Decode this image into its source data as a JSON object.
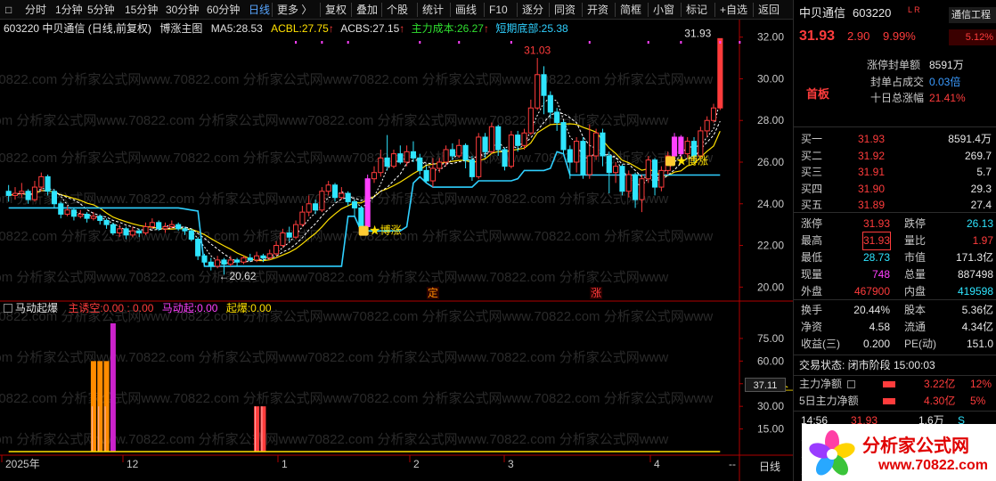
{
  "toolbar": {
    "items": [
      "分时",
      "1分钟",
      "5分钟",
      "15分钟",
      "30分钟",
      "60分钟",
      "日线",
      "更多 〉",
      "复权",
      "叠加",
      "个股",
      "统计",
      "画线",
      "F10",
      "逐分",
      "同资",
      "开资",
      "简框",
      "小窗",
      "标记",
      "+自选",
      "返回"
    ],
    "active_index": 6
  },
  "main_legend": {
    "code_name": "603220 中贝通信 (日线,前复权)",
    "indicator": "博涨主图",
    "ma5_label": "MA5:",
    "ma5_value": "28.53",
    "acbl_label": "ACBL:",
    "acbl_value": "27.75",
    "acbs_label": "ACBS:",
    "acbs_value": "27.15",
    "zlcb_label": "主力成本:",
    "zlcb_value": "26.27",
    "dqdb_label": "短期底部:",
    "dqdb_value": "25.38"
  },
  "sub_legend": {
    "name": "马动起爆",
    "zyk_label": "主诱空:",
    "zyk_value": "0.00 : 0.00",
    "mdq_label": "马动起:",
    "mdq_value": "0.00",
    "qb_label": "起爆:",
    "qb_value": "0.00"
  },
  "annotations": {
    "peak_label": "31.03",
    "low_label": "←20.62",
    "last_label": "31.93",
    "bozhang_1": "博涨",
    "bozhang_2": "博涨",
    "qibao": "起爆",
    "ding": "定",
    "zhang": "涨",
    "crosshair_value": "37.11"
  },
  "watermark": "70822.com 分析家公式网www.70822.com 分析家公式网www",
  "chart_data": [
    {
      "type": "candlestick",
      "ylim": [
        19.5,
        32.5
      ],
      "yticks": [
        "32.00",
        "30.00",
        "28.00",
        "26.00",
        "24.00",
        "22.00",
        "20.00"
      ],
      "ytick_values": [
        32,
        30,
        28,
        26,
        24,
        22,
        20
      ],
      "xlabels": [
        "2025年",
        "12",
        "1",
        "2",
        "3",
        "4"
      ],
      "candles": [
        [
          24.6,
          24.4,
          24.9,
          24.1
        ],
        [
          24.4,
          24.5,
          24.8,
          24.2
        ],
        [
          24.5,
          24.6,
          25.0,
          24.3
        ],
        [
          24.6,
          24.2,
          24.7,
          24.0
        ],
        [
          24.2,
          24.8,
          25.1,
          24.1
        ],
        [
          24.8,
          25.3,
          25.5,
          24.6
        ],
        [
          25.3,
          24.6,
          25.4,
          24.4
        ],
        [
          24.6,
          24.0,
          24.7,
          23.8
        ],
        [
          24.0,
          23.5,
          24.1,
          23.3
        ],
        [
          23.5,
          23.7,
          23.9,
          23.4
        ],
        [
          23.7,
          23.4,
          23.8,
          23.2
        ],
        [
          23.4,
          23.5,
          23.7,
          23.3
        ],
        [
          23.5,
          23.3,
          23.6,
          23.1
        ],
        [
          23.3,
          23.4,
          23.6,
          23.2
        ],
        [
          23.4,
          23.2,
          23.5,
          23.0
        ],
        [
          23.2,
          23.0,
          23.3,
          22.8
        ],
        [
          23.0,
          22.6,
          23.1,
          22.5
        ],
        [
          22.6,
          22.8,
          23.0,
          22.4
        ],
        [
          22.8,
          22.5,
          22.9,
          22.3
        ],
        [
          22.5,
          22.7,
          22.9,
          22.4
        ],
        [
          22.7,
          22.6,
          22.8,
          22.4
        ],
        [
          22.6,
          22.9,
          23.1,
          22.5
        ],
        [
          22.9,
          23.1,
          23.3,
          22.8
        ],
        [
          23.1,
          22.8,
          23.2,
          22.7
        ],
        [
          22.8,
          22.9,
          23.1,
          22.6
        ],
        [
          22.9,
          23.0,
          23.2,
          22.8
        ],
        [
          23.0,
          22.8,
          23.1,
          22.7
        ],
        [
          22.8,
          22.7,
          22.9,
          22.5
        ],
        [
          22.7,
          22.3,
          22.8,
          22.2
        ],
        [
          22.3,
          21.5,
          22.4,
          21.3
        ],
        [
          21.5,
          21.2,
          21.6,
          21.0
        ],
        [
          21.2,
          21.0,
          21.4,
          20.8
        ],
        [
          21.0,
          21.3,
          21.5,
          20.9
        ],
        [
          21.3,
          21.1,
          21.4,
          20.6
        ],
        [
          21.1,
          21.3,
          21.5,
          21.0
        ],
        [
          21.3,
          21.2,
          21.4,
          21.0
        ],
        [
          21.2,
          21.4,
          21.5,
          21.1
        ],
        [
          21.4,
          21.3,
          21.6,
          21.2
        ],
        [
          21.3,
          21.5,
          21.7,
          21.2
        ],
        [
          21.5,
          21.4,
          21.6,
          21.2
        ],
        [
          21.4,
          21.6,
          21.8,
          21.3
        ],
        [
          21.6,
          22.0,
          22.2,
          21.5
        ],
        [
          22.0,
          22.6,
          22.8,
          21.9
        ],
        [
          22.6,
          22.4,
          22.9,
          22.2
        ],
        [
          22.4,
          23.0,
          23.2,
          22.3
        ],
        [
          23.0,
          23.6,
          23.9,
          22.9
        ],
        [
          23.6,
          24.0,
          24.4,
          23.4
        ],
        [
          24.0,
          23.7,
          24.2,
          23.5
        ],
        [
          23.7,
          24.6,
          24.8,
          23.6
        ],
        [
          24.6,
          24.9,
          25.1,
          24.4
        ],
        [
          24.9,
          24.3,
          25.0,
          24.1
        ],
        [
          24.3,
          24.5,
          24.8,
          24.2
        ],
        [
          24.5,
          24.1,
          24.6,
          23.9
        ],
        [
          24.1,
          23.8,
          24.2,
          23.4
        ],
        [
          23.8,
          22.9,
          23.9,
          22.7
        ],
        [
          22.9,
          25.2,
          25.4,
          22.9
        ],
        [
          25.2,
          25.5,
          25.8,
          25.0
        ],
        [
          25.5,
          26.2,
          26.6,
          25.3
        ],
        [
          26.2,
          25.8,
          27.3,
          25.6
        ],
        [
          25.8,
          26.4,
          26.6,
          25.7
        ],
        [
          26.4,
          26.0,
          26.8,
          25.9
        ],
        [
          26.0,
          26.5,
          26.8,
          25.8
        ],
        [
          26.5,
          26.2,
          27.0,
          26.0
        ],
        [
          26.2,
          25.6,
          26.4,
          25.4
        ],
        [
          25.6,
          25.1,
          25.8,
          25.0
        ],
        [
          25.1,
          25.7,
          26.2,
          24.8
        ],
        [
          25.7,
          26.0,
          26.2,
          25.5
        ],
        [
          26.0,
          26.6,
          26.8,
          25.8
        ],
        [
          26.6,
          26.3,
          26.9,
          26.1
        ],
        [
          26.3,
          26.8,
          27.1,
          26.2
        ],
        [
          26.8,
          26.1,
          26.9,
          25.7
        ],
        [
          26.1,
          25.3,
          26.3,
          25.1
        ],
        [
          25.3,
          27.2,
          27.4,
          25.2
        ],
        [
          27.2,
          26.5,
          27.4,
          26.2
        ],
        [
          26.5,
          27.7,
          27.9,
          26.4
        ],
        [
          27.7,
          26.6,
          27.8,
          26.3
        ],
        [
          26.6,
          25.8,
          26.7,
          25.6
        ],
        [
          25.8,
          27.3,
          27.5,
          25.7
        ],
        [
          27.3,
          26.8,
          27.5,
          26.5
        ],
        [
          26.8,
          27.4,
          27.6,
          26.6
        ],
        [
          27.4,
          28.6,
          29.0,
          27.3
        ],
        [
          28.6,
          30.2,
          31.0,
          28.5
        ],
        [
          30.2,
          29.2,
          30.6,
          28.3
        ],
        [
          29.2,
          28.4,
          29.4,
          28.1
        ],
        [
          28.4,
          27.9,
          28.6,
          27.5
        ],
        [
          27.9,
          26.6,
          28.0,
          26.4
        ],
        [
          26.6,
          26.0,
          26.8,
          25.2
        ],
        [
          26.0,
          27.0,
          27.2,
          25.5
        ],
        [
          27.0,
          25.4,
          27.2,
          25.2
        ],
        [
          25.4,
          26.3,
          27.8,
          25.2
        ],
        [
          26.3,
          27.4,
          27.6,
          26.1
        ],
        [
          27.4,
          26.3,
          27.6,
          25.8
        ],
        [
          26.3,
          25.5,
          26.5,
          24.5
        ],
        [
          25.5,
          25.8,
          26.0,
          25.0
        ],
        [
          25.8,
          24.6,
          25.9,
          24.4
        ],
        [
          24.6,
          25.4,
          25.6,
          24.3
        ],
        [
          25.4,
          24.2,
          25.5,
          23.8
        ],
        [
          24.2,
          25.2,
          25.4,
          23.6
        ],
        [
          25.2,
          26.1,
          26.3,
          25.0
        ],
        [
          26.1,
          24.8,
          26.2,
          24.4
        ],
        [
          24.8,
          25.6,
          25.8,
          24.6
        ],
        [
          25.6,
          26.3,
          26.5,
          25.4
        ],
        [
          26.3,
          27.2,
          27.4,
          26.2
        ],
        [
          27.2,
          26.4,
          27.3,
          26.1
        ],
        [
          26.4,
          27.0,
          27.2,
          26.2
        ],
        [
          27.0,
          26.3,
          27.2,
          26.0
        ],
        [
          26.3,
          27.5,
          27.7,
          26.2
        ],
        [
          27.5,
          28.0,
          28.2,
          27.2
        ],
        [
          28.0,
          28.6,
          28.8,
          27.9
        ],
        [
          28.6,
          31.93,
          31.93,
          28.5
        ]
      ],
      "ma_series": [
        {
          "name": "ACBL",
          "color": "#ffe000"
        },
        {
          "name": "ACBS",
          "color": "#ffffff"
        },
        {
          "name": "MA5",
          "color": "#ffffff"
        }
      ],
      "dqdb_line_color": "#2fd0ff"
    },
    {
      "type": "bar",
      "ylim": [
        0,
        85
      ],
      "yticks": [
        "75.00",
        "60.00",
        "45.00",
        "30.00",
        "15.00"
      ],
      "ytick_values": [
        75,
        60,
        45,
        30,
        15
      ],
      "bars": [
        {
          "x_index": 13,
          "value": 60,
          "color": "#ff8c00"
        },
        {
          "x_index": 14,
          "value": 60,
          "color": "#ff8c00"
        },
        {
          "x_index": 15,
          "value": 60,
          "color": "#ff8c00"
        },
        {
          "x_index": 16,
          "value": 85,
          "color": "#cc22cc"
        },
        {
          "x_index": 38,
          "value": 30,
          "color": "#ff3c3c"
        },
        {
          "x_index": 39,
          "value": 30,
          "color": "#ff3c3c"
        }
      ],
      "qibao_series": {
        "peak_index": 118,
        "peak_value": 45,
        "color": "#ffe000"
      }
    }
  ],
  "right_panel": {
    "stock_name": "中贝通信",
    "stock_code": "603220",
    "flag": "L R",
    "sector": "通信工程",
    "sector_pct": "5.12%",
    "price": "31.93",
    "change": "2.90",
    "pct": "9.99%",
    "seal_label": "涨停封单额",
    "seal_value": "8591万",
    "ratio_label": "封单占成交",
    "ratio_value": "0.03倍",
    "ten_label": "十日总涨幅",
    "ten_value": "21.41%",
    "board_label": "首板",
    "bids": [
      {
        "label": "买一",
        "price": "31.93",
        "vol": "8591.4万"
      },
      {
        "label": "买二",
        "price": "31.92",
        "vol": "269.7"
      },
      {
        "label": "买三",
        "price": "31.91",
        "vol": "5.7"
      },
      {
        "label": "买四",
        "price": "31.90",
        "vol": "29.3"
      },
      {
        "label": "买五",
        "price": "31.89",
        "vol": "27.4"
      }
    ],
    "stats": [
      {
        "l1": "涨停",
        "v1": "31.93",
        "c1": "red",
        "l2": "跌停",
        "v2": "26.13",
        "c2": "green"
      },
      {
        "l1": "最高",
        "v1": "31.93",
        "c1": "red",
        "l2": "量比",
        "v2": "1.97",
        "c2": "red"
      },
      {
        "l1": "最低",
        "v1": "28.73",
        "c1": "green",
        "l2": "市值",
        "v2": "171.3亿",
        "c2": "white"
      },
      {
        "l1": "现量",
        "v1": "748",
        "c1": "pink",
        "l2": "总量",
        "v2": "887498",
        "c2": "white"
      },
      {
        "l1": "外盘",
        "v1": "467900",
        "c1": "red",
        "l2": "内盘",
        "v2": "419598",
        "c2": "green"
      }
    ],
    "stats2": [
      {
        "l1": "换手",
        "v1": "20.44%",
        "l2": "股本",
        "v2": "5.36亿"
      },
      {
        "l1": "净资",
        "v1": "4.58",
        "l2": "流通",
        "v2": "4.34亿"
      },
      {
        "l1": "收益(三)",
        "v1": "0.200",
        "l2": "PE(动)",
        "v2": "151.0"
      }
    ],
    "trade_status": "交易状态: 闭市阶段 15:00:03",
    "net1_label": "主力净额",
    "net1_value": "3.22亿",
    "net1_pct": "12%",
    "net5_label": "5日主力净额",
    "net5_value": "4.30亿",
    "net5_pct": "5%",
    "ticks": [
      {
        "time": "14:56",
        "price": "31.93",
        "vol": "1.6万",
        "side": "S"
      },
      {
        "time": "14:",
        "price": "",
        "vol": "",
        "side": ""
      },
      {
        "time": "14:",
        "price": "",
        "vol": "",
        "side": ""
      },
      {
        "time": "14:",
        "price": "",
        "vol": "",
        "side": ""
      }
    ]
  },
  "bottom": {
    "period": "日线",
    "logo_text": "分析家公式网",
    "logo_url": "www.70822.com"
  }
}
